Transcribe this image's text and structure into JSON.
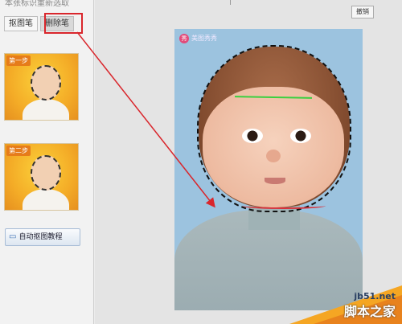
{
  "app": {
    "top_text": "本张标识重新选取"
  },
  "tools": {
    "tabs": [
      {
        "label": "抠图笔"
      },
      {
        "label": "删除笔"
      }
    ],
    "active_index": 1
  },
  "steps": [
    {
      "badge": "第一步"
    },
    {
      "badge": "第二步"
    }
  ],
  "tutorial_button": {
    "label": "自动抠图教程",
    "icon": "book-icon"
  },
  "canvas": {
    "undo_label": "撤销",
    "watermark_text": "美图秀秀"
  },
  "site": {
    "url": "jb51.net",
    "name": "脚本之家"
  },
  "colors": {
    "highlight": "#d9262c",
    "selection_green": "#3ad040",
    "neck_line": "#d8303a"
  }
}
